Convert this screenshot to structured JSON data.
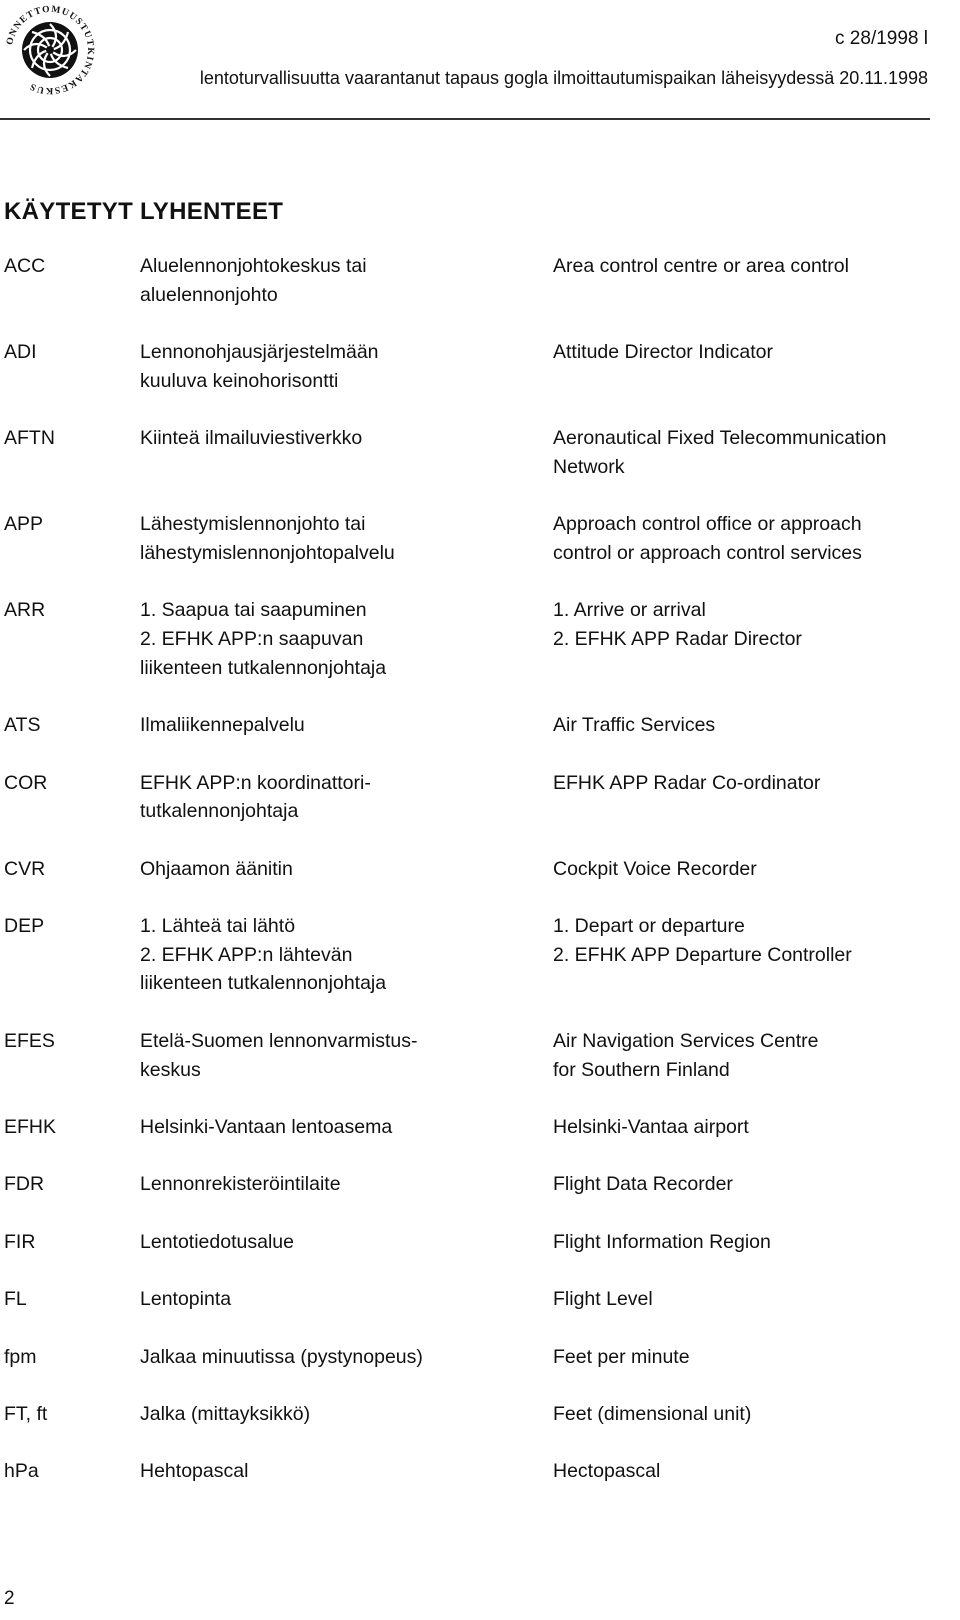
{
  "header": {
    "logo_text": "ONNETTOMUUSTUTKINTAKESKUS",
    "doc_id": "c 28/1998 l",
    "subtitle": "lentoturvallisuutta vaarantanut tapaus gogla ilmoittautumispaikan läheisyydessä 20.11.1998"
  },
  "heading": "KÄYTETYT LYHENTEET",
  "rows": [
    {
      "abbr": "ACC",
      "fi": [
        "Aluelennonjohtokeskus tai",
        "aluelennonjohto"
      ],
      "en": [
        "Area control centre or area control"
      ]
    },
    {
      "abbr": "ADI",
      "fi": [
        "Lennonohjausjärjestelmään",
        "kuuluva keinohorisontti"
      ],
      "en": [
        "Attitude Director Indicator"
      ]
    },
    {
      "abbr": "AFTN",
      "fi": [
        "Kiinteä ilmailuviestiverkko"
      ],
      "en": [
        "Aeronautical Fixed Telecommunication",
        "Network"
      ]
    },
    {
      "abbr": "APP",
      "fi": [
        "Lähestymislennonjohto tai",
        "lähestymislennonjohtopalvelu"
      ],
      "en": [
        "Approach control office or approach",
        "control or approach control services"
      ]
    },
    {
      "abbr": "ARR",
      "fi": [
        "1. Saapua tai saapuminen",
        "2. EFHK APP:n saapuvan",
        "liikenteen tutkalennonjohtaja"
      ],
      "en": [
        "1. Arrive or arrival",
        "2. EFHK APP Radar Director"
      ]
    },
    {
      "abbr": "ATS",
      "fi": [
        "Ilmaliikennepalvelu"
      ],
      "en": [
        "Air Traffic Services"
      ]
    },
    {
      "abbr": "COR",
      "fi": [
        "EFHK APP:n koordinattori-",
        "tutkalennonjohtaja"
      ],
      "en": [
        "EFHK APP Radar Co-ordinator"
      ]
    },
    {
      "abbr": "CVR",
      "fi": [
        "Ohjaamon äänitin"
      ],
      "en": [
        "Cockpit Voice Recorder"
      ]
    },
    {
      "abbr": "DEP",
      "fi": [
        "1. Lähteä tai lähtö",
        "2. EFHK APP:n lähtevän",
        "liikenteen tutkalennonjohtaja"
      ],
      "en": [
        "1. Depart or departure",
        "2. EFHK APP Departure Controller"
      ]
    },
    {
      "abbr": "EFES",
      "fi": [
        "Etelä-Suomen lennonvarmistus-",
        "keskus"
      ],
      "en": [
        "Air Navigation Services Centre",
        "for Southern Finland"
      ]
    },
    {
      "abbr": "EFHK",
      "fi": [
        "Helsinki-Vantaan lentoasema"
      ],
      "en": [
        "Helsinki-Vantaa airport"
      ]
    },
    {
      "abbr": "FDR",
      "fi": [
        "Lennonrekisteröintilaite"
      ],
      "en": [
        "Flight Data Recorder"
      ]
    },
    {
      "abbr": "FIR",
      "fi": [
        "Lentotiedotusalue"
      ],
      "en": [
        "Flight Information Region"
      ]
    },
    {
      "abbr": "FL",
      "fi": [
        "Lentopinta"
      ],
      "en": [
        "Flight Level"
      ]
    },
    {
      "abbr": "fpm",
      "fi": [
        "Jalkaa minuutissa (pystynopeus)"
      ],
      "en": [
        "Feet per minute"
      ]
    },
    {
      "abbr": "FT, ft",
      "fi": [
        "Jalka (mittayksikkö)"
      ],
      "en": [
        "Feet (dimensional unit)"
      ]
    },
    {
      "abbr": "hPa",
      "fi": [
        "Hehtopascal"
      ],
      "en": [
        "Hectopascal"
      ]
    }
  ],
  "page_number": "2"
}
